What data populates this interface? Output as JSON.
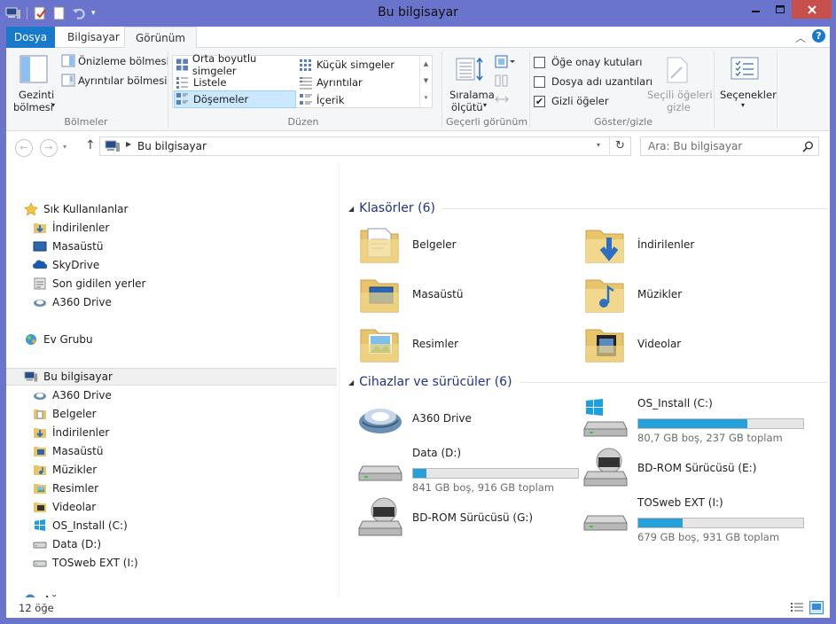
{
  "window": {
    "title": "Bu bilgisayar"
  },
  "ribbon": {
    "tabs": [
      {
        "label": "Dosya"
      },
      {
        "label": "Bilgisayar"
      },
      {
        "label": "Görünüm"
      }
    ],
    "panes_group": {
      "nav_pane_line1": "Gezinti",
      "nav_pane_line2": "bölmesi",
      "preview_pane": "Önizleme bölmesi",
      "details_pane": "Ayrıntılar bölmesi",
      "label": "Bölmeler"
    },
    "layout_group": {
      "items": [
        "Orta boyutlu simgeler",
        "Küçük simgeler",
        "Listele",
        "Ayrıntılar",
        "Döşemeler",
        "İçerik"
      ],
      "selected": "Döşemeler",
      "label": "Düzen"
    },
    "current_view_group": {
      "sort_line1": "Sıralama",
      "sort_line2": "ölçütü",
      "label": "Geçerli görünüm"
    },
    "show_hide_group": {
      "item_checkboxes": "Öğe onay kutuları",
      "file_extensions": "Dosya adı uzantıları",
      "hidden_items": "Gizli öğeler",
      "item_checkboxes_checked": false,
      "file_extensions_checked": false,
      "hidden_items_checked": true,
      "hide_selected_line1": "Seçili öğeleri",
      "hide_selected_line2": "gizle",
      "label": "Göster/gizle"
    },
    "options": {
      "label": "Seçenekler"
    }
  },
  "addressbar": {
    "path": "Bu bilgisayar",
    "search_placeholder": "Ara: Bu bilgisayar"
  },
  "navpane": {
    "favorites": {
      "label": "Sık Kullanılanlar",
      "items": [
        "İndirilenler",
        "Masaüstü",
        "SkyDrive",
        "Son gidilen yerler",
        "A360 Drive"
      ]
    },
    "homegroup": {
      "label": "Ev Grubu"
    },
    "thispc": {
      "label": "Bu bilgisayar",
      "items": [
        "A360 Drive",
        "Belgeler",
        "İndirilenler",
        "Masaüstü",
        "Müzikler",
        "Resimler",
        "Videolar",
        "OS_Install (C:)",
        "Data (D:)",
        "TOSweb EXT (I:)"
      ]
    },
    "network": {
      "label": "Ağ"
    }
  },
  "content": {
    "folders_header": "Klasörler (6)",
    "folders": [
      {
        "name": "Belgeler",
        "icon": "documents-folder-icon"
      },
      {
        "name": "İndirilenler",
        "icon": "downloads-folder-icon"
      },
      {
        "name": "Masaüstü",
        "icon": "desktop-folder-icon"
      },
      {
        "name": "Müzikler",
        "icon": "music-folder-icon"
      },
      {
        "name": "Resimler",
        "icon": "pictures-folder-icon"
      },
      {
        "name": "Videolar",
        "icon": "videos-folder-icon"
      }
    ],
    "devices_header": "Cihazlar ve sürücüler (6)",
    "devices": [
      {
        "name": "A360 Drive",
        "icon": "a360-drive-icon"
      },
      {
        "name": "OS_Install (C:)",
        "icon": "windows-drive-icon",
        "info": "80,7 GB boş, 237 GB toplam",
        "used_fraction": 0.66
      },
      {
        "name": "Data (D:)",
        "icon": "hard-drive-icon",
        "info": "841 GB boş, 916 GB toplam",
        "used_fraction": 0.08
      },
      {
        "name": "BD-ROM Sürücüsü (E:)",
        "icon": "bd-rom-drive-icon"
      },
      {
        "name": "BD-ROM Sürücüsü (G:)",
        "icon": "bd-rom-drive-icon"
      },
      {
        "name": "TOSweb EXT (I:)",
        "icon": "hard-drive-icon",
        "info": "679 GB boş, 931 GB toplam",
        "used_fraction": 0.27
      }
    ]
  },
  "status": {
    "item_count": "12 öğe"
  },
  "colors": {
    "frame": "#6b74cc",
    "file_tab": "#1979ca",
    "close_button": "#c7504a",
    "progress_fill": "#26a0da",
    "group_header": "#1e3287"
  }
}
